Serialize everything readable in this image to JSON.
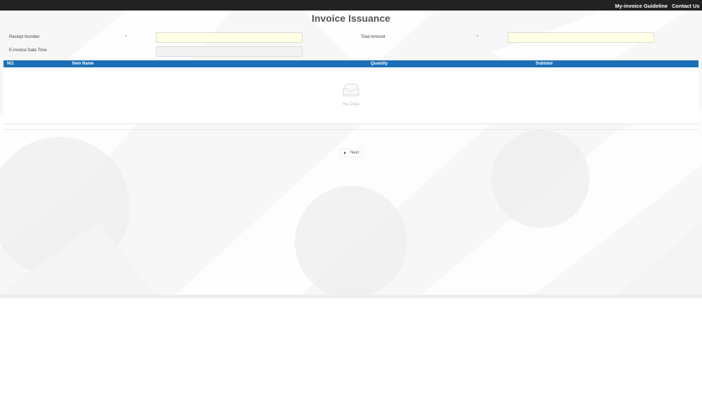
{
  "topbar": {
    "links": [
      "My-invoice Guideline",
      "Contact Us"
    ]
  },
  "page": {
    "title": "Invoice Issuance"
  },
  "form": {
    "receipt_number_label": "Receipt Number",
    "receipt_number_value": "",
    "total_amount_label": "Total Amount",
    "total_amount_value": "",
    "einvoice_datetime_label": "E-invoice Date Time",
    "einvoice_datetime_value": "",
    "required_mark": "*"
  },
  "table": {
    "columns": [
      "NO.",
      "Item Name",
      "Quantity",
      "Subtotal"
    ],
    "rows": [],
    "empty_text": "No Data"
  },
  "actions": {
    "next_label": "Next"
  },
  "colors": {
    "topbar": "#222222",
    "table_header": "#1a6fb6",
    "input_bg": "#ffffe6",
    "required": "#e0303a"
  },
  "icons": {
    "empty": "empty-inbox-icon",
    "next": "caret-right-icon"
  }
}
